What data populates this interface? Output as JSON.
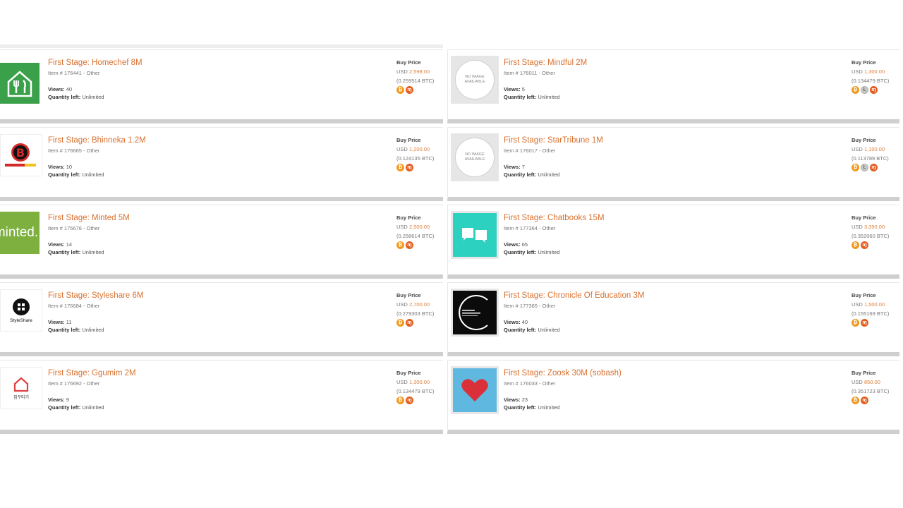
{
  "listings": [
    {
      "column": "left",
      "title": "First Stage: Homechef 8M",
      "item_line": "Item # 176441 - Other",
      "views_label": "Views:",
      "views": "40",
      "qty_label": "Quantity left:",
      "qty": "Unlimited",
      "buy_label": "Buy Price",
      "currency": "USD",
      "usd": "2,598.00",
      "btc": "(0.259514 BTC)",
      "logo": "homechef-logo",
      "payment_icons": [
        "bitcoin-icon",
        "monero-icon"
      ]
    },
    {
      "column": "right",
      "title": "First Stage: Mindful 2M",
      "item_line": "Item # 176011 - Other",
      "views_label": "Views:",
      "views": "5",
      "qty_label": "Quantity left:",
      "qty": "Unlimited",
      "buy_label": "Buy Price",
      "currency": "USD",
      "usd": "1,300.00",
      "btc": "(0.134479 BTC)",
      "logo": "no-image-placeholder",
      "placeholder_text": "NO IMAGE AVAILABLE",
      "payment_icons": [
        "bitcoin-icon",
        "litecoin-icon",
        "monero-icon"
      ]
    },
    {
      "column": "left",
      "title": "First Stage: Bhinneka 1.2M",
      "item_line": "Item # 176665 - Other",
      "views_label": "Views:",
      "views": "10",
      "qty_label": "Quantity left:",
      "qty": "Unlimited",
      "buy_label": "Buy Price",
      "currency": "USD",
      "usd": "1,200.00",
      "btc": "(0.124135 BTC)",
      "logo": "bhinneka-logo",
      "payment_icons": [
        "bitcoin-icon",
        "monero-icon"
      ]
    },
    {
      "column": "right",
      "title": "First Stage: StarTribune 1M",
      "item_line": "Item # 176017 - Other",
      "views_label": "Views:",
      "views": "7",
      "qty_label": "Quantity left:",
      "qty": "Unlimited",
      "buy_label": "Buy Price",
      "currency": "USD",
      "usd": "1,100.00",
      "btc": "(0.113789 BTC)",
      "logo": "no-image-placeholder",
      "placeholder_text": "NO IMAGE AVAILABLE",
      "payment_icons": [
        "bitcoin-icon",
        "litecoin-icon",
        "monero-icon"
      ]
    },
    {
      "column": "left",
      "title": "First Stage: Minted 5M",
      "item_line": "Item # 176676 - Other",
      "views_label": "Views:",
      "views": "14",
      "qty_label": "Quantity left:",
      "qty": "Unlimited",
      "buy_label": "Buy Price",
      "currency": "USD",
      "usd": "2,500.00",
      "btc": "(0.258614 BTC)",
      "logo": "minted-logo",
      "logo_text": "minted.",
      "payment_icons": [
        "bitcoin-icon",
        "monero-icon"
      ]
    },
    {
      "column": "right",
      "title": "First Stage: Chatbooks 15M",
      "item_line": "Item # 177364 - Other",
      "views_label": "Views:",
      "views": "65",
      "qty_label": "Quantity left:",
      "qty": "Unlimited",
      "buy_label": "Buy Price",
      "currency": "USD",
      "usd": "3,390.00",
      "btc": "(0.352060 BTC)",
      "logo": "chatbooks-logo",
      "payment_icons": [
        "bitcoin-icon",
        "monero-icon"
      ]
    },
    {
      "column": "left",
      "title": "First Stage: Styleshare 6M",
      "item_line": "Item # 176684 - Other",
      "views_label": "Views:",
      "views": "11",
      "qty_label": "Quantity left:",
      "qty": "Unlimited",
      "buy_label": "Buy Price",
      "currency": "USD",
      "usd": "2,700.00",
      "btc": "(0.279303 BTC)",
      "logo": "styleshare-logo",
      "logo_text": "StyleShare",
      "payment_icons": [
        "bitcoin-icon",
        "monero-icon"
      ]
    },
    {
      "column": "right",
      "title": "First Stage: Chronicle Of Education 3M",
      "item_line": "Item # 177365 - Other",
      "views_label": "Views:",
      "views": "40",
      "qty_label": "Quantity left:",
      "qty": "Unlimited",
      "buy_label": "Buy Price",
      "currency": "USD",
      "usd": "1,500.00",
      "btc": "(0.155169 BTC)",
      "logo": "chronicle-logo",
      "payment_icons": [
        "bitcoin-icon",
        "monero-icon"
      ]
    },
    {
      "column": "left",
      "title": "First Stage: Ggumim 2M",
      "item_line": "Item # 176692 - Other",
      "views_label": "Views:",
      "views": "9",
      "qty_label": "Quantity left:",
      "qty": "Unlimited",
      "buy_label": "Buy Price",
      "currency": "USD",
      "usd": "1,300.00",
      "btc": "(0.134479 BTC)",
      "logo": "ggumim-logo",
      "logo_text": "집꾸미기",
      "payment_icons": [
        "bitcoin-icon",
        "monero-icon"
      ]
    },
    {
      "column": "right",
      "title": "First Stage: Zoosk 30M (sobash)",
      "item_line": "Item # 176033 - Other",
      "views_label": "Views:",
      "views": "23",
      "qty_label": "Quantity left:",
      "qty": "Unlimited",
      "buy_label": "Buy Price",
      "currency": "USD",
      "usd": "850.00",
      "btc": "(0.351723 BTC)",
      "logo": "zoosk-logo",
      "payment_icons": [
        "bitcoin-icon",
        "monero-icon"
      ]
    }
  ],
  "colors": {
    "title": "#d9712f",
    "price": "#e0813c",
    "homechef": "#3aa04a",
    "minted": "#7db03f",
    "chatbooks": "#2dd1c0",
    "zoosk_bg": "#5fb8e0",
    "zoosk_heart": "#d9303a"
  }
}
